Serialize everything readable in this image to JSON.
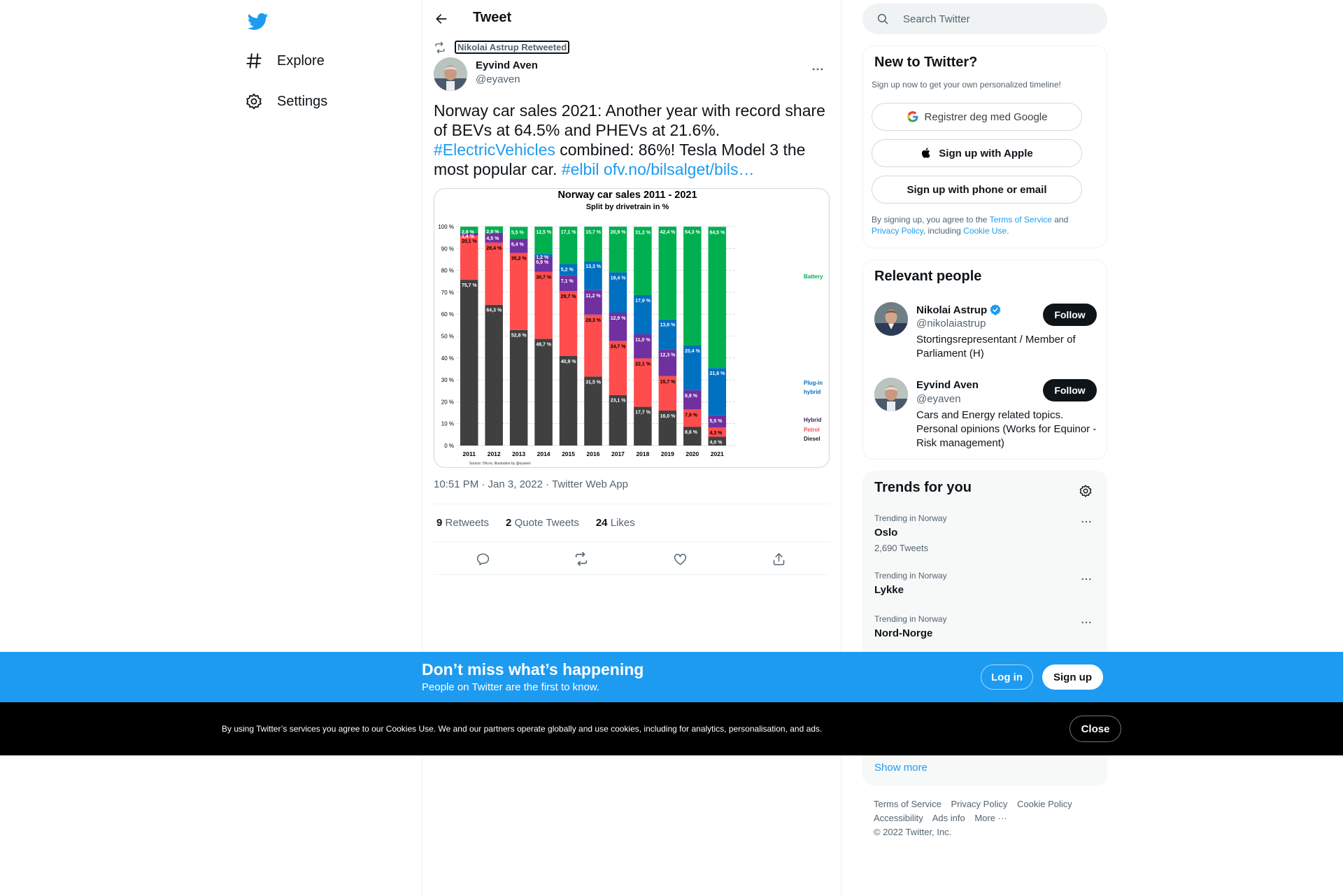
{
  "nav": {
    "logo": "twitter-bird-icon",
    "items": [
      {
        "label": "Explore",
        "icon": "hashtag-icon"
      },
      {
        "label": "Settings",
        "icon": "gear-icon"
      }
    ]
  },
  "header": {
    "title": "Tweet"
  },
  "tweet": {
    "retweeted_by": "Nikolai Astrup Retweeted",
    "author_name": "Eyvind Aven",
    "author_handle": "@eyaven",
    "text_part1": "Norway car sales 2021: Another year with record share of BEVs at 64.5% and PHEVs at 21.6%. ",
    "hashtag1": "#ElectricVehicles",
    "text_part2": " combined: 86%! Tesla Model 3 the most popular car. ",
    "hashtag2": "#elbil",
    "link": "ofv.no/bilsalget/bils…",
    "timestamp": "10:51 PM · Jan 3, 2022 · Twitter Web App",
    "retweets_count": "9",
    "retweets_label": "Retweets",
    "quotes_count": "2",
    "quotes_label": "Quote Tweets",
    "likes_count": "24",
    "likes_label": "Likes"
  },
  "search": {
    "placeholder": "Search Twitter"
  },
  "new_to_twitter": {
    "title": "New to Twitter?",
    "subtitle": "Sign up now to get your own personalized timeline!",
    "google_label": "Registrer deg med Google",
    "apple_label": "Sign up with Apple",
    "phone_label": "Sign up with phone or email",
    "terms_prefix": "By signing up, you agree to the ",
    "terms_link": "Terms of Service",
    "terms_and": " and ",
    "privacy_link": "Privacy Policy",
    "terms_including": ", including ",
    "cookie_link": "Cookie Use."
  },
  "relevant_people": {
    "title": "Relevant people",
    "people": [
      {
        "name": "Nikolai Astrup",
        "handle": "@nikolaiastrup",
        "bio": "Stortingsrepresentant / Member of Parliament (H)",
        "verified": true,
        "follow": "Follow"
      },
      {
        "name": "Eyvind Aven",
        "handle": "@eyaven",
        "bio": "Cars and Energy related topics. Personal opinions (Works for Equinor - Risk management)",
        "verified": false,
        "follow": "Follow"
      }
    ]
  },
  "trends": {
    "title": "Trends for you",
    "items": [
      {
        "context": "Trending in Norway",
        "name": "Oslo",
        "count": "2,690 Tweets"
      },
      {
        "context": "Trending in Norway",
        "name": "Lykke",
        "count": ""
      },
      {
        "context": "Trending in Norway",
        "name": "Nord-Norge",
        "count": ""
      }
    ],
    "show_more": "Show more"
  },
  "footer": {
    "links": [
      "Terms of Service",
      "Privacy Policy",
      "Cookie Policy",
      "Accessibility",
      "Ads info",
      "More ···"
    ],
    "copyright": "© 2022 Twitter, Inc."
  },
  "banner": {
    "title": "Don’t miss what’s happening",
    "subtitle": "People on Twitter are the first to know.",
    "login": "Log in",
    "signup": "Sign up"
  },
  "cookie": {
    "text": "By using Twitter’s services you agree to our Cookies Use. We and our partners operate globally and use cookies, including for analytics, personalisation, and ads.",
    "close": "Close"
  },
  "colors": {
    "accent": "#1d9bf0",
    "battery": "#00b050",
    "plugin_hybrid": "#0070c0",
    "hybrid": "#7030a0",
    "petrol": "#ff4d4d",
    "diesel": "#404040"
  },
  "chart_data": {
    "type": "bar",
    "stacked": true,
    "title": "Norway car sales 2011 - 2021",
    "subtitle": "Split by drivetrain in %",
    "source": "Source: Ofv.no, Illustration by @eyaven",
    "categories": [
      "2011",
      "2012",
      "2013",
      "2014",
      "2015",
      "2016",
      "2017",
      "2018",
      "2019",
      "2020",
      "2021"
    ],
    "y_ticks": [
      "0 %",
      "10 %",
      "20 %",
      "30 %",
      "40 %",
      "50 %",
      "60 %",
      "70 %",
      "80 %",
      "90 %",
      "100 %"
    ],
    "ylim": [
      0,
      100
    ],
    "grid": true,
    "legend_position": "right",
    "series": [
      {
        "name": "Diesel",
        "color": "#404040",
        "values": [
          75.7,
          64.3,
          52.8,
          48.7,
          40.9,
          31.5,
          23.1,
          17.7,
          16.0,
          8.6,
          4.0
        ],
        "labels": [
          "75,7 %",
          "64,3 %",
          "52,8 %",
          "48,7 %",
          "40,9 %",
          "31,5 %",
          "23,1 %",
          "17,7 %",
          "16,0 %",
          "8,6 %",
          "4,0 %"
        ]
      },
      {
        "name": "Petrol",
        "color": "#ff4d4d",
        "values": [
          20.1,
          28.4,
          35.2,
          30.7,
          29.7,
          28.3,
          24.7,
          22.1,
          15.7,
          7.9,
          4.3
        ],
        "labels": [
          "20,1 %",
          "28,4 %",
          "35,2 %",
          "30,7 %",
          "29,7 %",
          "28,3 %",
          "24,7 %",
          "22,1 %",
          "15,7 %",
          "7,9 %",
          "4,3 %"
        ]
      },
      {
        "name": "Hybrid",
        "color": "#7030a0",
        "values": [
          1.4,
          4.5,
          6.4,
          6.9,
          7.1,
          11.2,
          12.9,
          11.0,
          12.3,
          8.8,
          5.5
        ],
        "labels": [
          "1,4 %",
          "4,5 %",
          "6,4 %",
          "6,9 %",
          "7,1 %",
          "11,2 %",
          "12,9 %",
          "11,0 %",
          "12,3 %",
          "8,8 %",
          "5,5 %"
        ]
      },
      {
        "name": "Plug-in hybrid",
        "color": "#0070c0",
        "values": [
          0,
          0,
          0,
          1.2,
          5.2,
          13.3,
          18.4,
          17.9,
          13.6,
          20.4,
          21.6
        ],
        "labels": [
          "",
          "",
          "",
          "1,2 %",
          "5,2 %",
          "13,3 %",
          "18,4 %",
          "17,9 %",
          "13,6 %",
          "20,4 %",
          "21,6 %"
        ]
      },
      {
        "name": "Battery",
        "color": "#00b050",
        "values": [
          2.8,
          2.9,
          5.5,
          12.5,
          17.1,
          15.7,
          20.9,
          31.2,
          42.4,
          54.3,
          64.5
        ],
        "labels": [
          "2,8 %",
          "2,9 %",
          "5,5 %",
          "12,5 %",
          "17,1 %",
          "15,7 %",
          "20,9 %",
          "31,2 %",
          "42,4 %",
          "54,3 %",
          "64,5 %"
        ]
      }
    ]
  }
}
